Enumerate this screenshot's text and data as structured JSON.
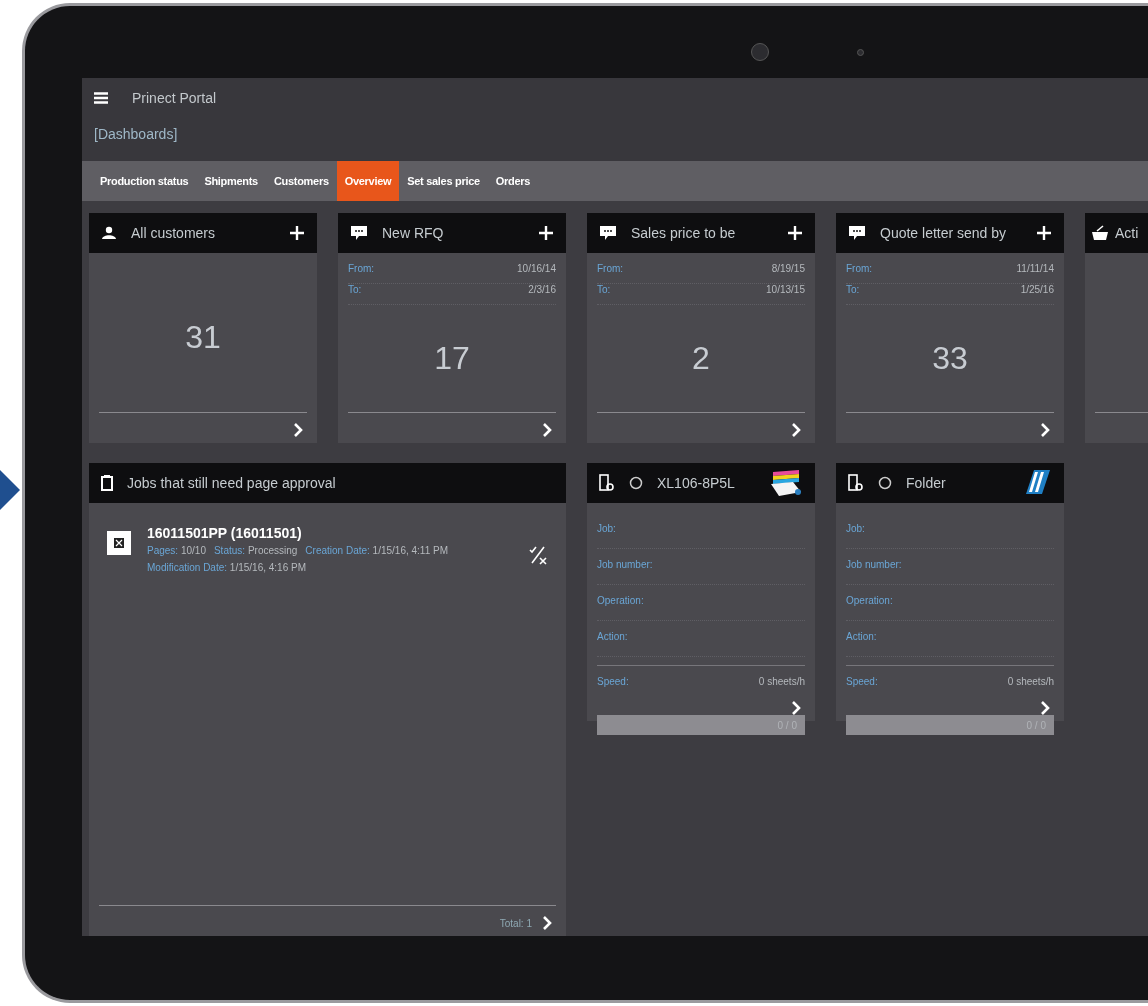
{
  "app": {
    "title": "Prinect Portal",
    "breadcrumb": "[Dashboards]"
  },
  "tabs": [
    {
      "label": "Production status",
      "selected": false
    },
    {
      "label": "Shipments",
      "selected": false
    },
    {
      "label": "Customers",
      "selected": false
    },
    {
      "label": "Overview",
      "selected": true
    },
    {
      "label": "Set sales price",
      "selected": false
    },
    {
      "label": "Orders",
      "selected": false
    }
  ],
  "tiles": [
    {
      "kind": "count",
      "title": "All customers",
      "count": "31"
    },
    {
      "kind": "date_range",
      "title": "New RFQ",
      "from_label": "From:",
      "from": "10/16/14",
      "to_label": "To:",
      "to": "2/3/16",
      "count": "17"
    },
    {
      "kind": "date_range",
      "title": "Sales price to be",
      "from_label": "From:",
      "from": "8/19/15",
      "to_label": "To:",
      "to": "10/13/15",
      "count": "2"
    },
    {
      "kind": "date_range",
      "title": "Quote letter send by",
      "from_label": "From:",
      "from": "11/11/14",
      "to_label": "To:",
      "to": "1/25/16",
      "count": "33"
    },
    {
      "kind": "partial",
      "title": "Acti"
    }
  ],
  "approval": {
    "title": "Jobs that still need page approval",
    "total": "Total: 1",
    "jobs": [
      {
        "title": "16011501PP (16011501)",
        "fields": [
          {
            "label": "Pages:",
            "value": "10/10"
          },
          {
            "label": "Status:",
            "value": "Processing"
          },
          {
            "label": "Creation Date:",
            "value": "1/15/16, 4:11 PM"
          },
          {
            "label": "Modification Date:",
            "value": "1/15/16, 4:16 PM"
          }
        ]
      }
    ]
  },
  "machines": [
    {
      "name": "XL106-8P5L",
      "fields": [
        {
          "label": "Job:"
        },
        {
          "label": "Job number:"
        },
        {
          "label": "Operation:"
        },
        {
          "label": "Action:"
        }
      ],
      "speed_label": "Speed:",
      "speed": "0 sheets/h",
      "progress": "0 / 0",
      "level": 0
    },
    {
      "name": "Folder",
      "fields": [
        {
          "label": "Job:"
        },
        {
          "label": "Job number:"
        },
        {
          "label": "Operation:"
        },
        {
          "label": "Action:"
        }
      ],
      "speed_label": "Speed:",
      "speed": "0 sheets/h",
      "progress": "0 / 0",
      "level": 0
    }
  ]
}
